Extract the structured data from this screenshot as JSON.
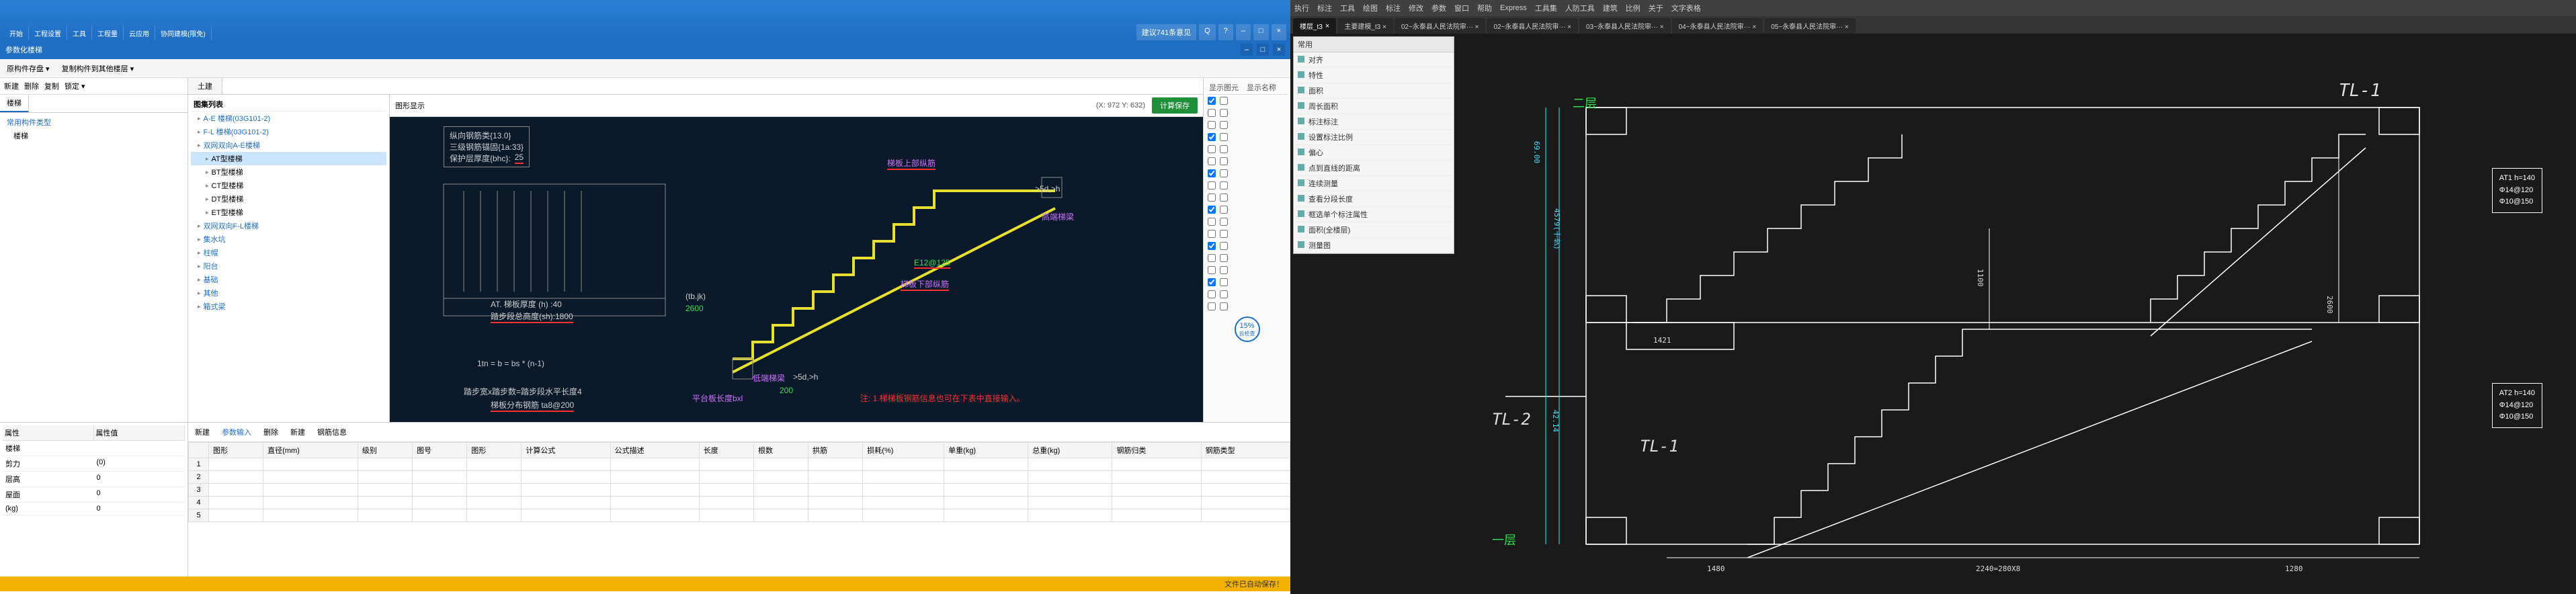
{
  "leftApp": {
    "ribbon": {
      "items": [
        "开始",
        "工程设置",
        "工具",
        "工程量",
        "云应用",
        "协同建模(限免)"
      ],
      "right": [
        "建议741条意见",
        "Q",
        "?",
        "–",
        "□",
        "×"
      ]
    },
    "subTitle": "参数化楼梯",
    "winBtns": [
      "–",
      "□",
      "×"
    ],
    "toolbar": {
      "lock": "原构件存盘 ▾",
      "copy": "复制构件到其他楼层 ▾"
    },
    "lpBtns": [
      "新建",
      "删除",
      "复制",
      "锁定 ▾"
    ],
    "lpTabs": [
      "楼梯"
    ],
    "lpTree": [
      "常用构件类型",
      "楼梯"
    ],
    "midTabs": [
      "土建"
    ],
    "treeHead": "图集列表",
    "tree2": [
      {
        "label": "A-E 楼梯(03G101-2)",
        "lvl": 0
      },
      {
        "label": "F-L 楼梯(03G101-2)",
        "lvl": 0
      },
      {
        "label": "双网双向A-E楼梯",
        "lvl": 0
      },
      {
        "label": "AT型楼梯",
        "lvl": 1,
        "sel": true
      },
      {
        "label": "BT型楼梯",
        "lvl": 1
      },
      {
        "label": "CT型楼梯",
        "lvl": 1
      },
      {
        "label": "DT型楼梯",
        "lvl": 1
      },
      {
        "label": "ET型楼梯",
        "lvl": 1
      },
      {
        "label": "双网双向F-L楼梯",
        "lvl": 0
      },
      {
        "label": "集水坑",
        "lvl": 0
      },
      {
        "label": "柱帽",
        "lvl": 0
      },
      {
        "label": "阳台",
        "lvl": 0
      },
      {
        "label": "基础",
        "lvl": 0
      },
      {
        "label": "其他",
        "lvl": 0
      },
      {
        "label": "箱式梁",
        "lvl": 0
      }
    ],
    "canvasHead": {
      "label": "图形显示",
      "coord": "(X: 972 Y: 632)",
      "save": "计算保存"
    },
    "canvas": {
      "paramLines": [
        "纵向钢筋类{13.0}",
        "三级钢筋锚固{1a:33}",
        "保护层厚度{bhc}:"
      ],
      "paramVals": [
        "",
        "",
        "25"
      ],
      "mid1": "AT. 梯板厚度 (h) :40",
      "mid2": "踏步段总高度(sh):1800",
      "leftDim1": "(tb.jk)",
      "leftDim2": "2600",
      "stairTop": "梯板上部纵筋",
      "stairTopVal": "E12@125",
      "stairRight": "高端梯梁",
      "stairLow": "梯板下部纵筋",
      "stairBot": "低端梯梁",
      "rule1": ">5d,>h",
      "rule2": "200",
      "rule3": ">5d,>h",
      "formula": "1tn = b = bs * (n-1)",
      "bottom1": "踏步宽x踏步数=踏步段水平长度4",
      "bottom2": "梯板分布钢筋 ta8@200",
      "note": "注: 1.梯梯板钢筋信息也可在下表中直接输入。",
      "dimB": "平台板长度bxl"
    },
    "props": {
      "head": [
        "属性",
        "属性值"
      ],
      "rows": [
        [
          "楼梯",
          ""
        ],
        [
          "剪力",
          "(0)"
        ],
        [
          "层高",
          "0"
        ],
        [
          "屋面",
          "0"
        ],
        [
          "(kg)",
          "0"
        ]
      ]
    },
    "gridTb": [
      "新建",
      "参数输入",
      "删除",
      "新建",
      "钢筋信息"
    ],
    "gridCols": [
      "图形",
      "直径(mm)",
      "级别",
      "图号",
      "图形",
      "计算公式",
      "公式描述",
      "长度",
      "根数",
      "拱筋",
      "损耗(%)",
      "单重(kg)",
      "总重(kg)",
      "钢筋归类",
      "钢筋类型"
    ],
    "gridRows": [
      "1",
      "2",
      "3",
      "4",
      "5"
    ],
    "rightPane": {
      "head": [
        "显示图元",
        "显示名称"
      ],
      "blank": "显示",
      "rows": 18,
      "badge": "15%",
      "badgeSub": "云检查"
    },
    "status": "文件已自动保存！"
  },
  "rightApp": {
    "menu": [
      "执行",
      "标注",
      "工具",
      "绘图",
      "标注",
      "修改",
      "参数",
      "窗口",
      "帮助",
      "Express",
      "工具集",
      "人防工具",
      "建筑",
      "比例",
      "关于",
      "文字表格"
    ],
    "tabs": [
      {
        "label": "楼层_t3",
        "active": true,
        "close": "×"
      },
      {
        "label": "主要建模_t3 ×"
      },
      {
        "label": "02~永泰县人民法院审··· ×"
      },
      {
        "label": "02~永泰县人民法院审··· ×"
      },
      {
        "label": "03~永泰县人民法院审··· ×"
      },
      {
        "label": "04~永泰县人民法院审··· ×"
      },
      {
        "label": "05~永泰县人民法院审··· ×"
      }
    ],
    "sidePanel": {
      "head": "常用",
      "items": [
        "对齐",
        "特性",
        "面积",
        "周长面积",
        "标注标注",
        "设置标注比例",
        "偏心",
        "点到直线的距离",
        "连续测量",
        "查看分段长度",
        "框选单个标注属性",
        "面积(全楼层)",
        "测量图"
      ]
    },
    "marked2F": "二层",
    "marked1F": "一层",
    "tl1": "TL-1",
    "tl2": "TL-2",
    "tl1b": "TL-1",
    "dim6900": "69.00",
    "dim4579": "4579(十步)",
    "dim4214": "42.14",
    "dim1100": "1100",
    "dim1421": "1421",
    "dim2600": "2600",
    "dimBot1": "1480",
    "dimBot2": "2240=280X8",
    "dimBot3": "1280",
    "annot1": {
      "title": "AT1 h=140",
      "l2": "Φ14@120",
      "l3": "Φ10@150"
    },
    "annot2": {
      "title": "AT2 h=140",
      "l2": "Φ14@120",
      "l3": "Φ10@150"
    }
  }
}
